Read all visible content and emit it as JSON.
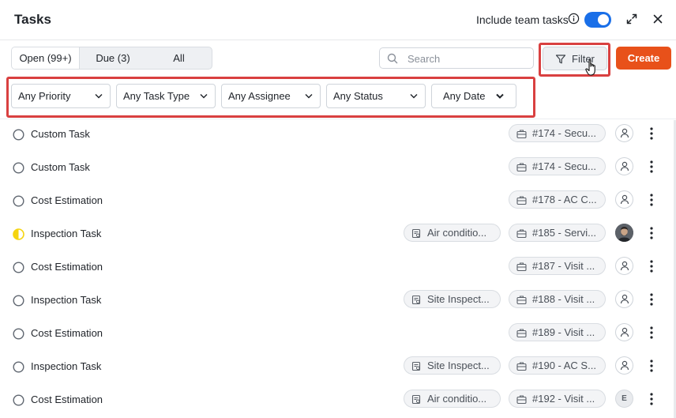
{
  "header": {
    "title": "Tasks",
    "team_toggle_label": "Include team tasks",
    "team_toggle_on": true,
    "info_icon": "info-icon",
    "expand_icon": "expand-icon",
    "close_icon": "close-icon"
  },
  "tabs": [
    {
      "label": "Open (99+)",
      "selected": true
    },
    {
      "label": "Due (3)",
      "selected": false
    },
    {
      "label": "All",
      "selected": false
    }
  ],
  "search": {
    "placeholder": "Search",
    "icon": "search-icon"
  },
  "filter_button": {
    "label": "Filter",
    "icon": "filter-icon"
  },
  "create_button": {
    "label": "Create"
  },
  "filters": [
    {
      "label": "Any Priority"
    },
    {
      "label": "Any Task Type"
    },
    {
      "label": "Any Assignee"
    },
    {
      "label": "Any Status"
    },
    {
      "label": "Any Date"
    }
  ],
  "colors": {
    "accent_blue": "#1a6fe8",
    "create_orange": "#e8511a",
    "highlight_red": "#d94040",
    "status_in_progress": "#f5d40f"
  },
  "tasks": [
    {
      "name": "Custom Task",
      "status": "open",
      "asset": "",
      "ref": "#174 - Secu...",
      "assignee": "user-icon"
    },
    {
      "name": "Custom Task",
      "status": "open",
      "asset": "",
      "ref": "#174 - Secu...",
      "assignee": "user-icon"
    },
    {
      "name": "Cost Estimation",
      "status": "open",
      "asset": "",
      "ref": "#178 - AC C...",
      "assignee": "user-icon"
    },
    {
      "name": "Inspection Task",
      "status": "in-progress",
      "asset": "Air conditio...",
      "ref": "#185 - Servi...",
      "assignee": "photo"
    },
    {
      "name": "Cost Estimation",
      "status": "open",
      "asset": "",
      "ref": "#187 - Visit ...",
      "assignee": "user-icon"
    },
    {
      "name": "Inspection Task",
      "status": "open",
      "asset": "Site Inspect...",
      "ref": "#188 - Visit ...",
      "assignee": "user-icon"
    },
    {
      "name": "Cost Estimation",
      "status": "open",
      "asset": "",
      "ref": "#189 - Visit ...",
      "assignee": "user-icon"
    },
    {
      "name": "Inspection Task",
      "status": "open",
      "asset": "Site Inspect...",
      "ref": "#190 - AC S...",
      "assignee": "user-icon"
    },
    {
      "name": "Cost Estimation",
      "status": "open",
      "asset": "Air conditio...",
      "ref": "#192 - Visit ...",
      "assignee": "E"
    }
  ]
}
